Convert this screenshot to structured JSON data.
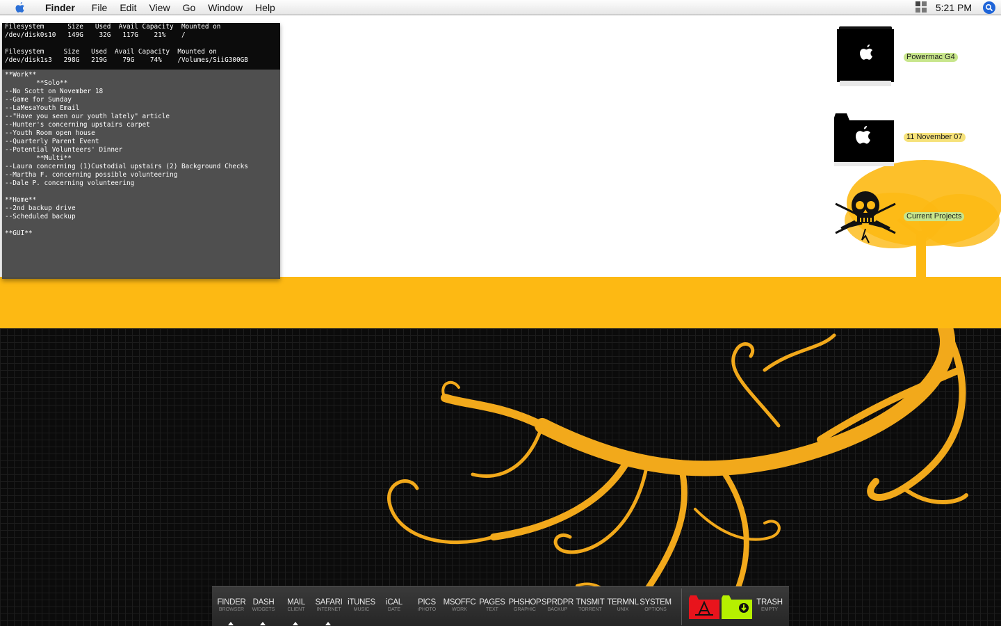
{
  "menubar": {
    "app_name": "Finder",
    "menus": [
      "File",
      "Edit",
      "View",
      "Go",
      "Window",
      "Help"
    ],
    "clock": "5:21 PM",
    "icons": [
      "apple-icon",
      "spaces-icon",
      "spotlight-icon"
    ]
  },
  "terminal": {
    "df_output": "Filesystem      Size   Used  Avail Capacity  Mounted on\n/dev/disk0s10   149G    32G   117G    21%    /\n\nFilesystem     Size   Used  Avail Capacity  Mounted on\n/dev/disk1s3   298G   219G    79G    74%    /Volumes/SiiG300GB",
    "notes": "**Work**\n        **Solo**\n--No Scott on November 18\n--Game for Sunday\n--LaMesaYouth Email\n--\"Have you seen our youth lately\" article\n--Hunter's concerning upstairs carpet\n--Youth Room open house\n--Quarterly Parent Event\n--Potential Volunteers' Dinner\n        **Multi**\n--Laura concerning (1)Custodial upstairs (2) Background Checks\n--Martha F. concerning possible volunteering\n--Dale P. concerning volunteering\n\n**Home**\n--2nd backup drive\n--Scheduled backup\n\n**GUI**"
  },
  "desktop_icons": [
    {
      "label": "Powermac G4",
      "icon": "powermac-drive-icon"
    },
    {
      "label": "11 November 07",
      "icon": "apple-folder-icon"
    },
    {
      "label": "Current Projects",
      "icon": "skull-folder-icon"
    }
  ],
  "dock": {
    "items": [
      {
        "label": "FINDER",
        "sub": "BROWSER",
        "running": true
      },
      {
        "label": "DASH",
        "sub": "WIDGETS",
        "running": true
      },
      {
        "label": "MAIL",
        "sub": "CLIENT",
        "running": true
      },
      {
        "label": "SAFARI",
        "sub": "INTERNET",
        "running": true
      },
      {
        "label": "iTUNES",
        "sub": "MUSIC",
        "running": false
      },
      {
        "label": "iCAL",
        "sub": "DATE",
        "running": false
      },
      {
        "label": "PICS",
        "sub": "iPHOTO",
        "running": false
      },
      {
        "label": "MSOFFC",
        "sub": "WORK",
        "running": false
      },
      {
        "label": "PAGES",
        "sub": "TEXT",
        "running": false
      },
      {
        "label": "PHSHOP",
        "sub": "GRAPHIC",
        "running": false
      },
      {
        "label": "SPRDPR",
        "sub": "BACKUP",
        "running": false
      },
      {
        "label": "TNSMIT",
        "sub": "TORRENT",
        "running": false
      },
      {
        "label": "TERMNL",
        "sub": "UNIX",
        "running": false
      },
      {
        "label": "SYSTEM",
        "sub": "OPTIONS",
        "running": false
      }
    ],
    "stacks": [
      {
        "name": "applications-stack-icon",
        "color": "#e8141c"
      },
      {
        "name": "downloads-stack-icon",
        "color": "#b6f000"
      }
    ],
    "trash": {
      "label": "TRASH",
      "sub": "EMPTY"
    }
  },
  "colors": {
    "accent_yellow": "#fdb913",
    "label_green": "#c8e68c",
    "label_yellow": "#f6e27a"
  }
}
